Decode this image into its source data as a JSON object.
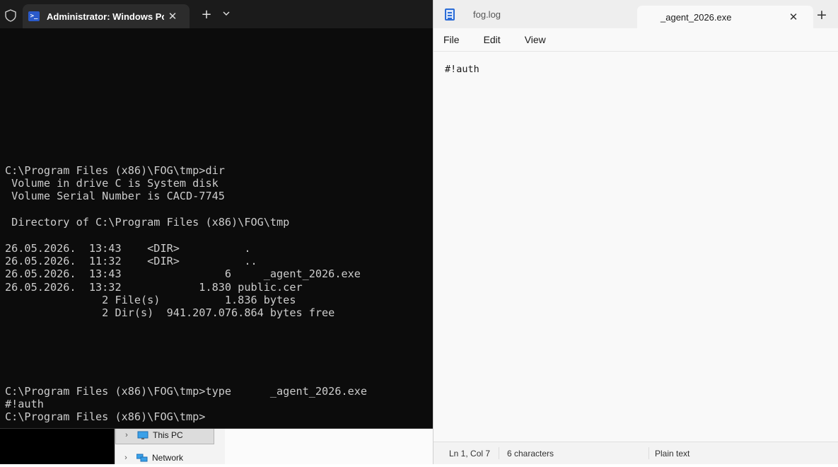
{
  "terminal": {
    "tab_title": "Administrator: Windows PowerShell",
    "tab_close": "✕",
    "new_tab": "+",
    "dropdown": "⌄",
    "icon": "powershell-icon",
    "lines": [
      "C:\\Program Files (x86)\\FOG\\tmp>dir",
      " Volume in drive C is System disk",
      " Volume Serial Number is CACD-7745",
      "",
      " Directory of C:\\Program Files (x86)\\FOG\\tmp",
      "",
      "26.05.2026.  13:43    <DIR>          .",
      "26.05.2026.  11:32    <DIR>          ..",
      "26.05.2026.  13:43                6     _agent_2026.exe",
      "26.05.2026.  13:32            1.830 public.cer",
      "               2 File(s)          1.836 bytes",
      "               2 Dir(s)  941.207.076.864 bytes free"
    ],
    "bottom_lines": [
      "C:\\Program Files (x86)\\FOG\\tmp>type      _agent_2026.exe",
      "#!auth",
      "C:\\Program Files (x86)\\FOG\\tmp>"
    ]
  },
  "explorer": {
    "nav_items": [
      {
        "label": "This PC",
        "icon": "computer-icon",
        "chevron": "›"
      },
      {
        "label": "Network",
        "icon": "network-icon",
        "chevron": "›"
      }
    ]
  },
  "notepad": {
    "tabs": [
      {
        "label": "fog.log",
        "icon": "notepad-file-icon"
      },
      {
        "label": "_agent_2026.exe"
      }
    ],
    "tab_close": "✕",
    "new_tab": "+",
    "menu": [
      "File",
      "Edit",
      "View"
    ],
    "content": "#!auth",
    "status": {
      "position": "Ln 1, Col 7",
      "characters": "6 characters",
      "encoding": "Plain text"
    }
  }
}
